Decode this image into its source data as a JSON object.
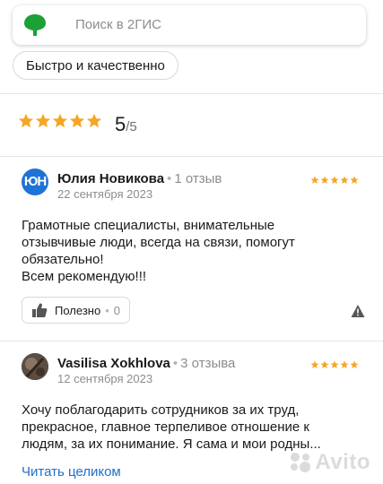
{
  "search": {
    "logo_icon": "2gis-leaf-logo",
    "placeholder": "Поиск в 2ГИС"
  },
  "filter_chip": {
    "label": "Быстро и качественно"
  },
  "rating_summary": {
    "stars": 5,
    "score": "5",
    "max": "/5"
  },
  "reviews": [
    {
      "avatar_initials": "ЮН",
      "author": "Юлия Новикова",
      "separator": "•",
      "reviews_count": "1 отзыв",
      "date": "22 сентября 2023",
      "stars": 5,
      "text": "Грамотные специалисты, внимательные\nотзывчивые люди, всегда на связи, помогут\nобязательно!\nВсем рекомендую!!!",
      "helpful_label": "Полезно",
      "helpful_separator": "•",
      "helpful_count": "0"
    },
    {
      "author": "Vasilisa Xokhlova",
      "separator": "•",
      "reviews_count": "3 отзыва",
      "date": "12 сентября 2023",
      "stars": 5,
      "text": "Хочу поблагодарить сотрудников за их труд,\nпрекрасное, главное терпеливое отношение к\nлюдям, за их понимание. Я сама и мои родны...",
      "read_more": "Читать целиком"
    }
  ],
  "watermark": {
    "text": "Avito"
  },
  "colors": {
    "star": "#f5a623",
    "brand_green": "#1ba136",
    "link": "#1e6fc9",
    "avatar_blue": "#1e73d6"
  }
}
